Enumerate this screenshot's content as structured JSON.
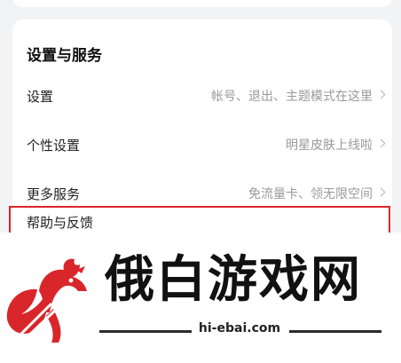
{
  "section": {
    "title": "设置与服务",
    "rows": [
      {
        "label": "设置",
        "hint": "帐号、退出、主题模式在这里"
      },
      {
        "label": "个性设置",
        "hint": "明星皮肤上线啦"
      },
      {
        "label": "更多服务",
        "hint": "免流量卡、领无限空间"
      },
      {
        "label": "帮助与反馈",
        "hint": ""
      }
    ]
  },
  "watermark": {
    "brand": "俄白游戏网",
    "url": "hi-ebai.com"
  },
  "colors": {
    "highlight": "#d9262b",
    "logo_red": "#d9262b",
    "background": "#f2f3f5",
    "card": "#ffffff",
    "hint_text": "#9a9a9a"
  }
}
